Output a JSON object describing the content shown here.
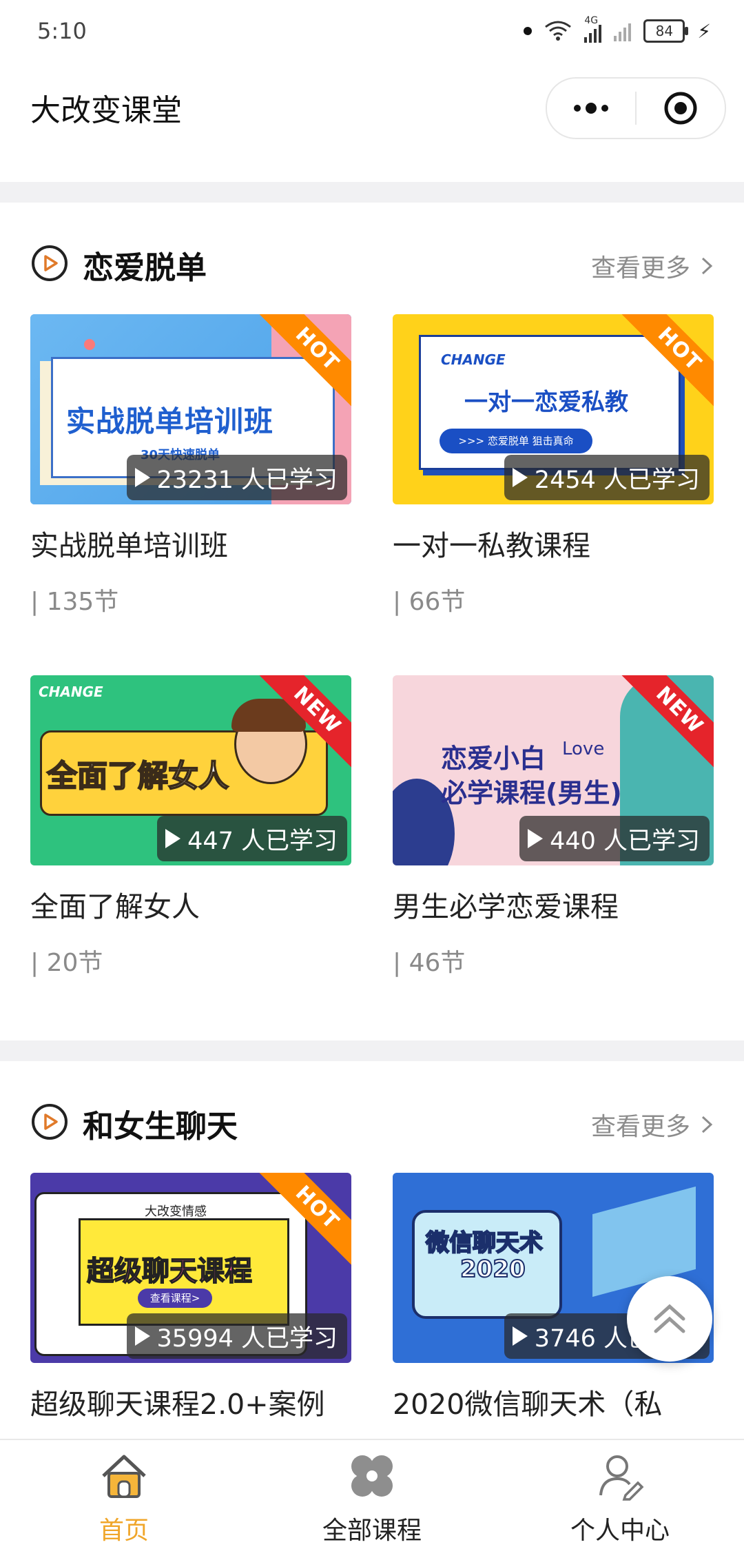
{
  "status": {
    "time": "5:10",
    "network": "4G",
    "battery": "84"
  },
  "header": {
    "title": "大改变课堂",
    "more_icon": "more-dots-icon",
    "close_icon": "target-close-icon"
  },
  "sections": [
    {
      "title": "恋爱脱单",
      "more_label": "查看更多",
      "courses": [
        {
          "title": "实战脱单培训班",
          "lessons": "| 135节",
          "learners": "23231 人已学习",
          "badge": "HOT",
          "thumb_title": "实战脱单培训班",
          "thumb_sub": "30天快速脱单"
        },
        {
          "title": "一对一私教课程",
          "lessons": "| 66节",
          "learners": "2454 人已学习",
          "badge": "HOT",
          "thumb_brand": "CHANGE",
          "thumb_title": "一对一恋爱私教",
          "thumb_sub": ">>> 恋爱脱单  狙击真命"
        },
        {
          "title": "全面了解女人",
          "lessons": "| 20节",
          "learners": "447 人已学习",
          "badge": "NEW",
          "thumb_brand": "CHANGE",
          "thumb_title": "全面了解女人"
        },
        {
          "title": "男生必学恋爱课程",
          "lessons": "| 46节",
          "learners": "440 人已学习",
          "badge": "NEW",
          "thumb_title": "恋爱小白",
          "thumb_title2": "必学课程(男生)",
          "thumb_love": "Love"
        }
      ]
    },
    {
      "title": "和女生聊天",
      "more_label": "查看更多",
      "courses": [
        {
          "title": "超级聊天课程2.0+案例",
          "learners": "35994 人已学习",
          "badge": "HOT",
          "thumb_top": "大改变情感",
          "thumb_title": "超级聊天课程",
          "thumb_btn": "查看课程>"
        },
        {
          "title": "2020微信聊天术（私",
          "learners": "3746 人已学习",
          "thumb_title": "微信聊天术",
          "thumb_title2": "2020"
        }
      ]
    }
  ],
  "tabbar": [
    {
      "label": "首页",
      "icon": "home-icon",
      "active": true
    },
    {
      "label": "全部课程",
      "icon": "clover-icon",
      "active": false
    },
    {
      "label": "个人中心",
      "icon": "user-edit-icon",
      "active": false
    }
  ],
  "colors": {
    "accent": "#f0a62a",
    "hot_badge": "#ff8a00",
    "new_badge": "#e5242b",
    "grey_text": "#8a8a8a"
  }
}
